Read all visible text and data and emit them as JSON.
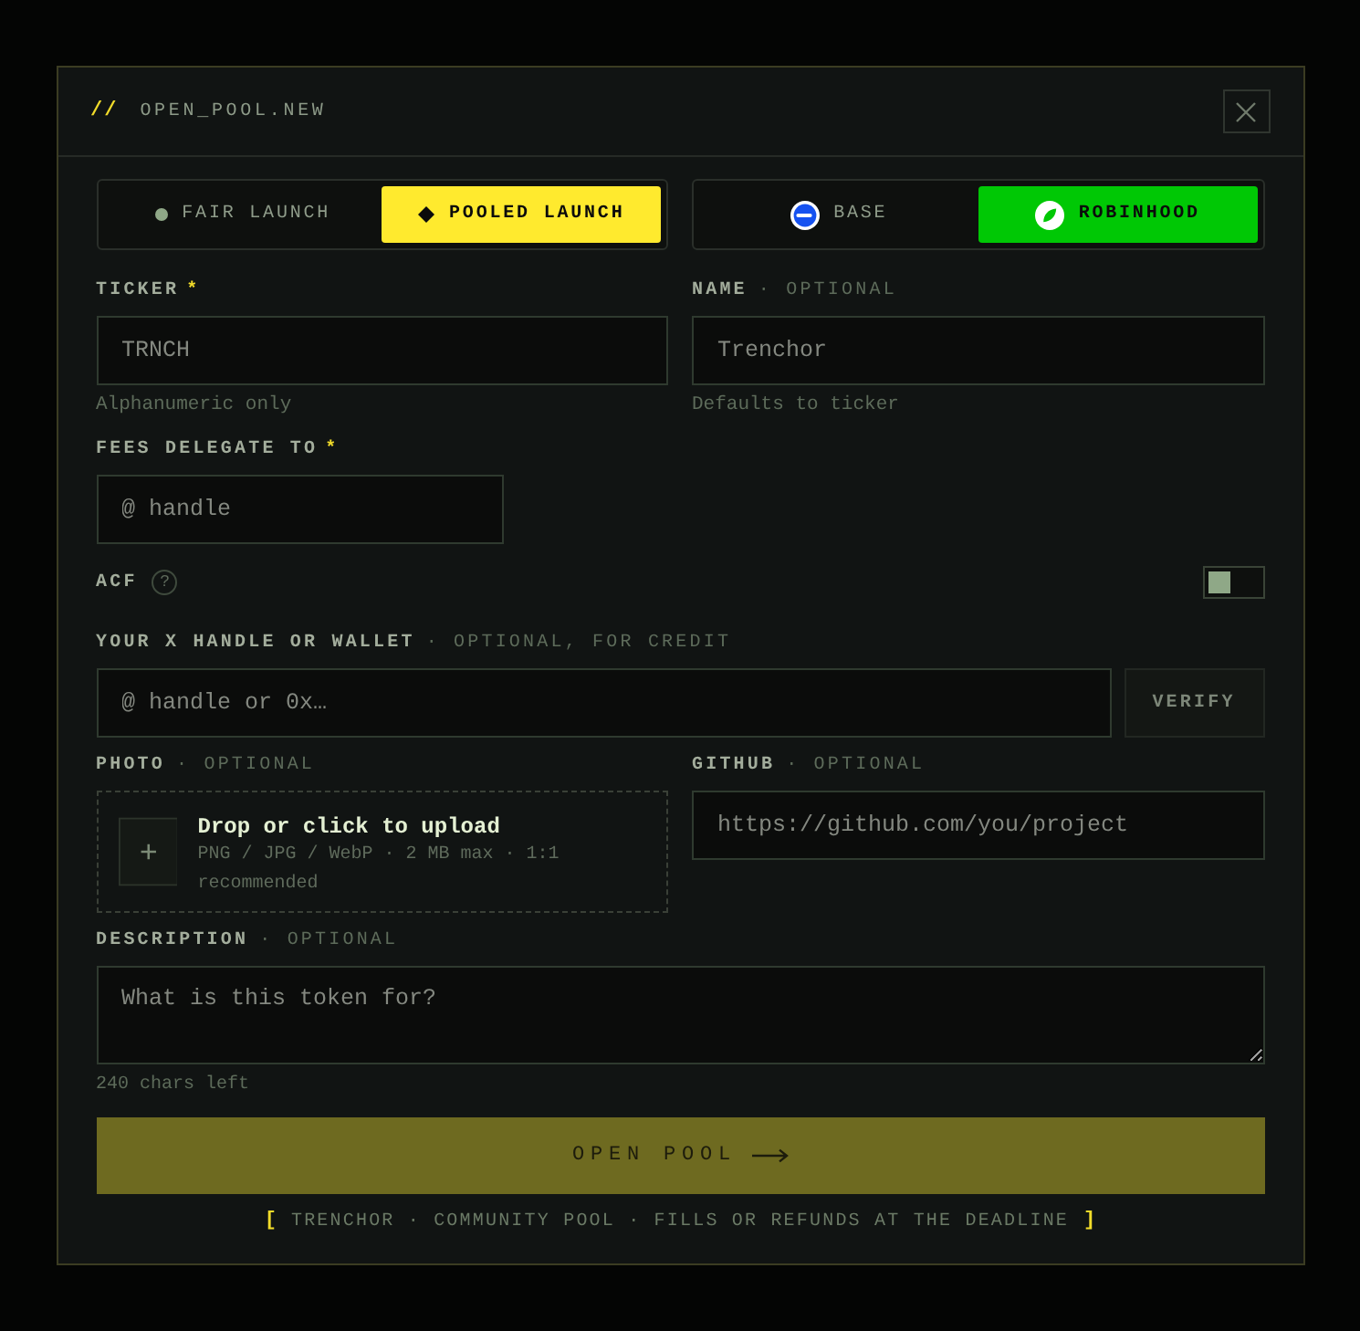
{
  "dialog": {
    "prefix": "//",
    "title": "OPEN_POOL.NEW"
  },
  "launch_modes": [
    {
      "label": "FAIR LAUNCH",
      "selected": false
    },
    {
      "label": "POOLED LAUNCH",
      "selected": true
    }
  ],
  "networks": [
    {
      "label": "BASE",
      "selected": false
    },
    {
      "label": "ROBINHOOD",
      "selected": true
    }
  ],
  "ticker": {
    "label": "TICKER",
    "required": "*",
    "placeholder": "TRNCH",
    "hint": "Alphanumeric only"
  },
  "name": {
    "label": "NAME",
    "note": "· OPTIONAL",
    "placeholder": "Trenchor",
    "hint": "Defaults to ticker"
  },
  "fees_delegate": {
    "label": "FEES DELEGATE TO",
    "required": "*",
    "placeholder": "@ handle"
  },
  "acf": {
    "label": "ACF",
    "help": "?",
    "on": false
  },
  "x_handle": {
    "label": "YOUR X HANDLE OR WALLET",
    "note": "· OPTIONAL, FOR CREDIT",
    "placeholder": "@ handle or 0x…",
    "button": "VERIFY"
  },
  "photo": {
    "label": "PHOTO",
    "note": "· OPTIONAL",
    "title": "Drop or click to upload",
    "details": "PNG / JPG / WebP · 2 MB max · 1:1 recommended"
  },
  "github": {
    "label": "GITHUB",
    "note": "· OPTIONAL",
    "placeholder": "https://github.com/you/project"
  },
  "description": {
    "label": "DESCRIPTION",
    "note": "· OPTIONAL",
    "placeholder": "What is this token for?",
    "counter": "240 chars left"
  },
  "submit": {
    "label": "OPEN POOL"
  },
  "footer": {
    "open": "[",
    "text": "TRENCHOR · COMMUNITY POOL · FILLS OR REFUNDS AT THE DEADLINE",
    "close": "]"
  }
}
